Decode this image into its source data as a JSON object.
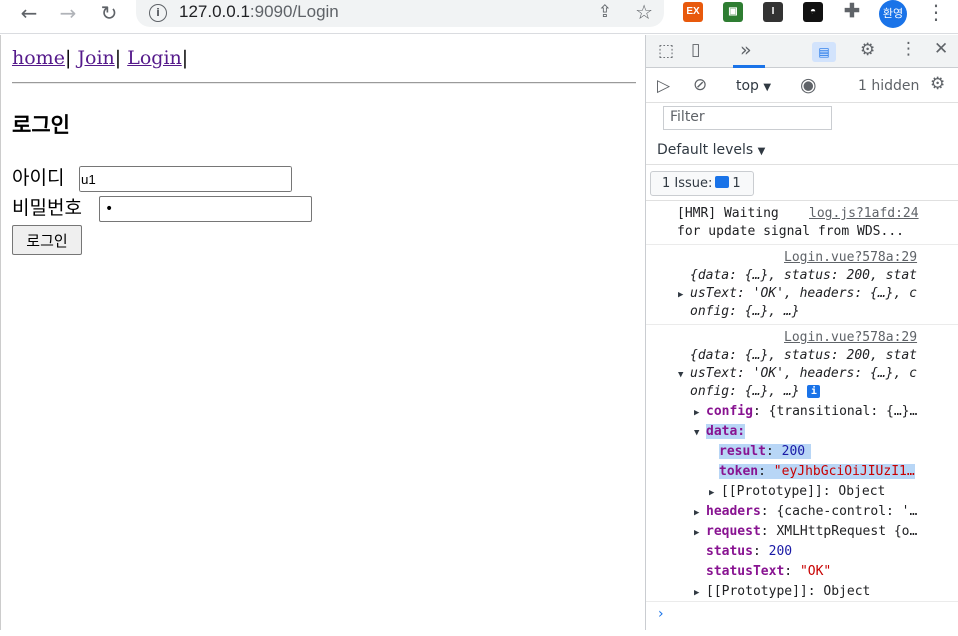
{
  "browser": {
    "url_host": "127.0.0.1",
    "url_rest": ":9090/Login",
    "profile_label": "환영",
    "extensions": [
      {
        "name": "ex-extension-icon",
        "label": "EX",
        "color": "#e8590c"
      },
      {
        "name": "screen-extension-icon",
        "label": "▣",
        "color": "#2e7d32"
      },
      {
        "name": "notion-extension-icon",
        "label": "I",
        "color": "#333333"
      },
      {
        "name": "incognito-extension-icon",
        "label": "◓",
        "color": "#111111"
      }
    ]
  },
  "page": {
    "nav": {
      "home": "home",
      "sep": "|",
      "join": "Join",
      "login": "Login"
    },
    "heading": "로그인",
    "id_label": "아이디",
    "id_value": "u1",
    "pw_label": "비밀번호",
    "pw_value": "•",
    "submit": "로그인"
  },
  "devtools": {
    "context": "top",
    "hidden": "1 hidden",
    "filter_placeholder": "Filter",
    "levels": "Default levels",
    "issues_label": "1 Issue:",
    "issues_count": "1",
    "messages": {
      "hmr_line1": "[HMR] Waiting",
      "hmr_line2": "for update signal from WDS...",
      "hmr_src": "log.js?1afd:24",
      "src1": "Login.vue?578a:29",
      "src2": "Login.vue?578a:29",
      "obj_line1": "{data: {…}, status: 200, stat",
      "obj_line2": "usText: 'OK', headers: {…}, c",
      "obj_line3": "onfig: {…}, …}",
      "config_key": "config",
      "config_val": "{transitional: {…}…",
      "data_key": "data:",
      "result_key": "result",
      "result_val": "200",
      "token_key": "token",
      "token_val": "\"eyJhbGciOiJIUzI1…",
      "proto_key": "[[Prototype]]",
      "proto_val": "Object",
      "headers_key": "headers",
      "headers_val": "{cache-control: '…",
      "request_key": "request",
      "request_val": "XMLHttpRequest {o…",
      "status_key": "status",
      "status_val": "200",
      "statustext_key": "statusText",
      "statustext_val": "\"OK\"",
      "proto2_key": "[[Prototype]]",
      "proto2_val": "Object"
    }
  }
}
